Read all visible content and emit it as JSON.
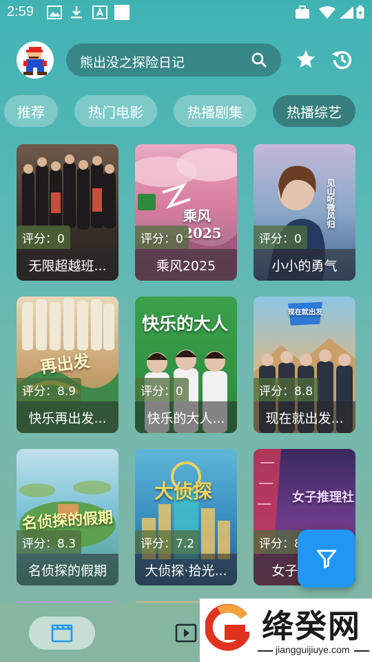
{
  "status_bar": {
    "time": "2:59"
  },
  "header": {
    "search_text": "熊出没之探险日记"
  },
  "tabs": [
    {
      "label": "推荐"
    },
    {
      "label": "热门电影"
    },
    {
      "label": "热播剧集"
    },
    {
      "label": "热播综艺"
    }
  ],
  "active_tab": "热播综艺",
  "cards": [
    {
      "score": "评分：0",
      "title": "无限超越班...",
      "poster_text": ""
    },
    {
      "score": "评分：0",
      "title": "乘风2025",
      "poster_text": "乘风2025"
    },
    {
      "score": "评分：0",
      "title": "小小的勇气",
      "poster_text": "见山听微风归"
    },
    {
      "score": "评分：8.9",
      "title": "快乐再出发...",
      "poster_text": "再出发"
    },
    {
      "score": "评分：0",
      "title": "快乐的大人...",
      "poster_text": "快乐的大人"
    },
    {
      "score": "评分：8.8",
      "title": "现在就出发...",
      "poster_text": "现在就出发"
    },
    {
      "score": "评分：8.3",
      "title": "名侦探的假期",
      "poster_text": "名侦探的假期"
    },
    {
      "score": "评分：7.2",
      "title": "大侦探·拾光...",
      "poster_text": "大侦探"
    },
    {
      "score": "评分：8",
      "title": "女子推理社",
      "poster_text": "女子推理社"
    }
  ],
  "watermark": {
    "brand": "绛癸网",
    "url": "jiangguijiuye.com"
  },
  "icons": {
    "avatar": "mario-avatar",
    "search": "search-icon",
    "favorite": "star-icon",
    "history": "history-icon",
    "filter": "filter-icon",
    "nav_movies": "clapperboard-icon",
    "nav_video": "video-play-icon"
  },
  "colors": {
    "fab": "#2196f3",
    "accent": "#3fb3b4"
  }
}
